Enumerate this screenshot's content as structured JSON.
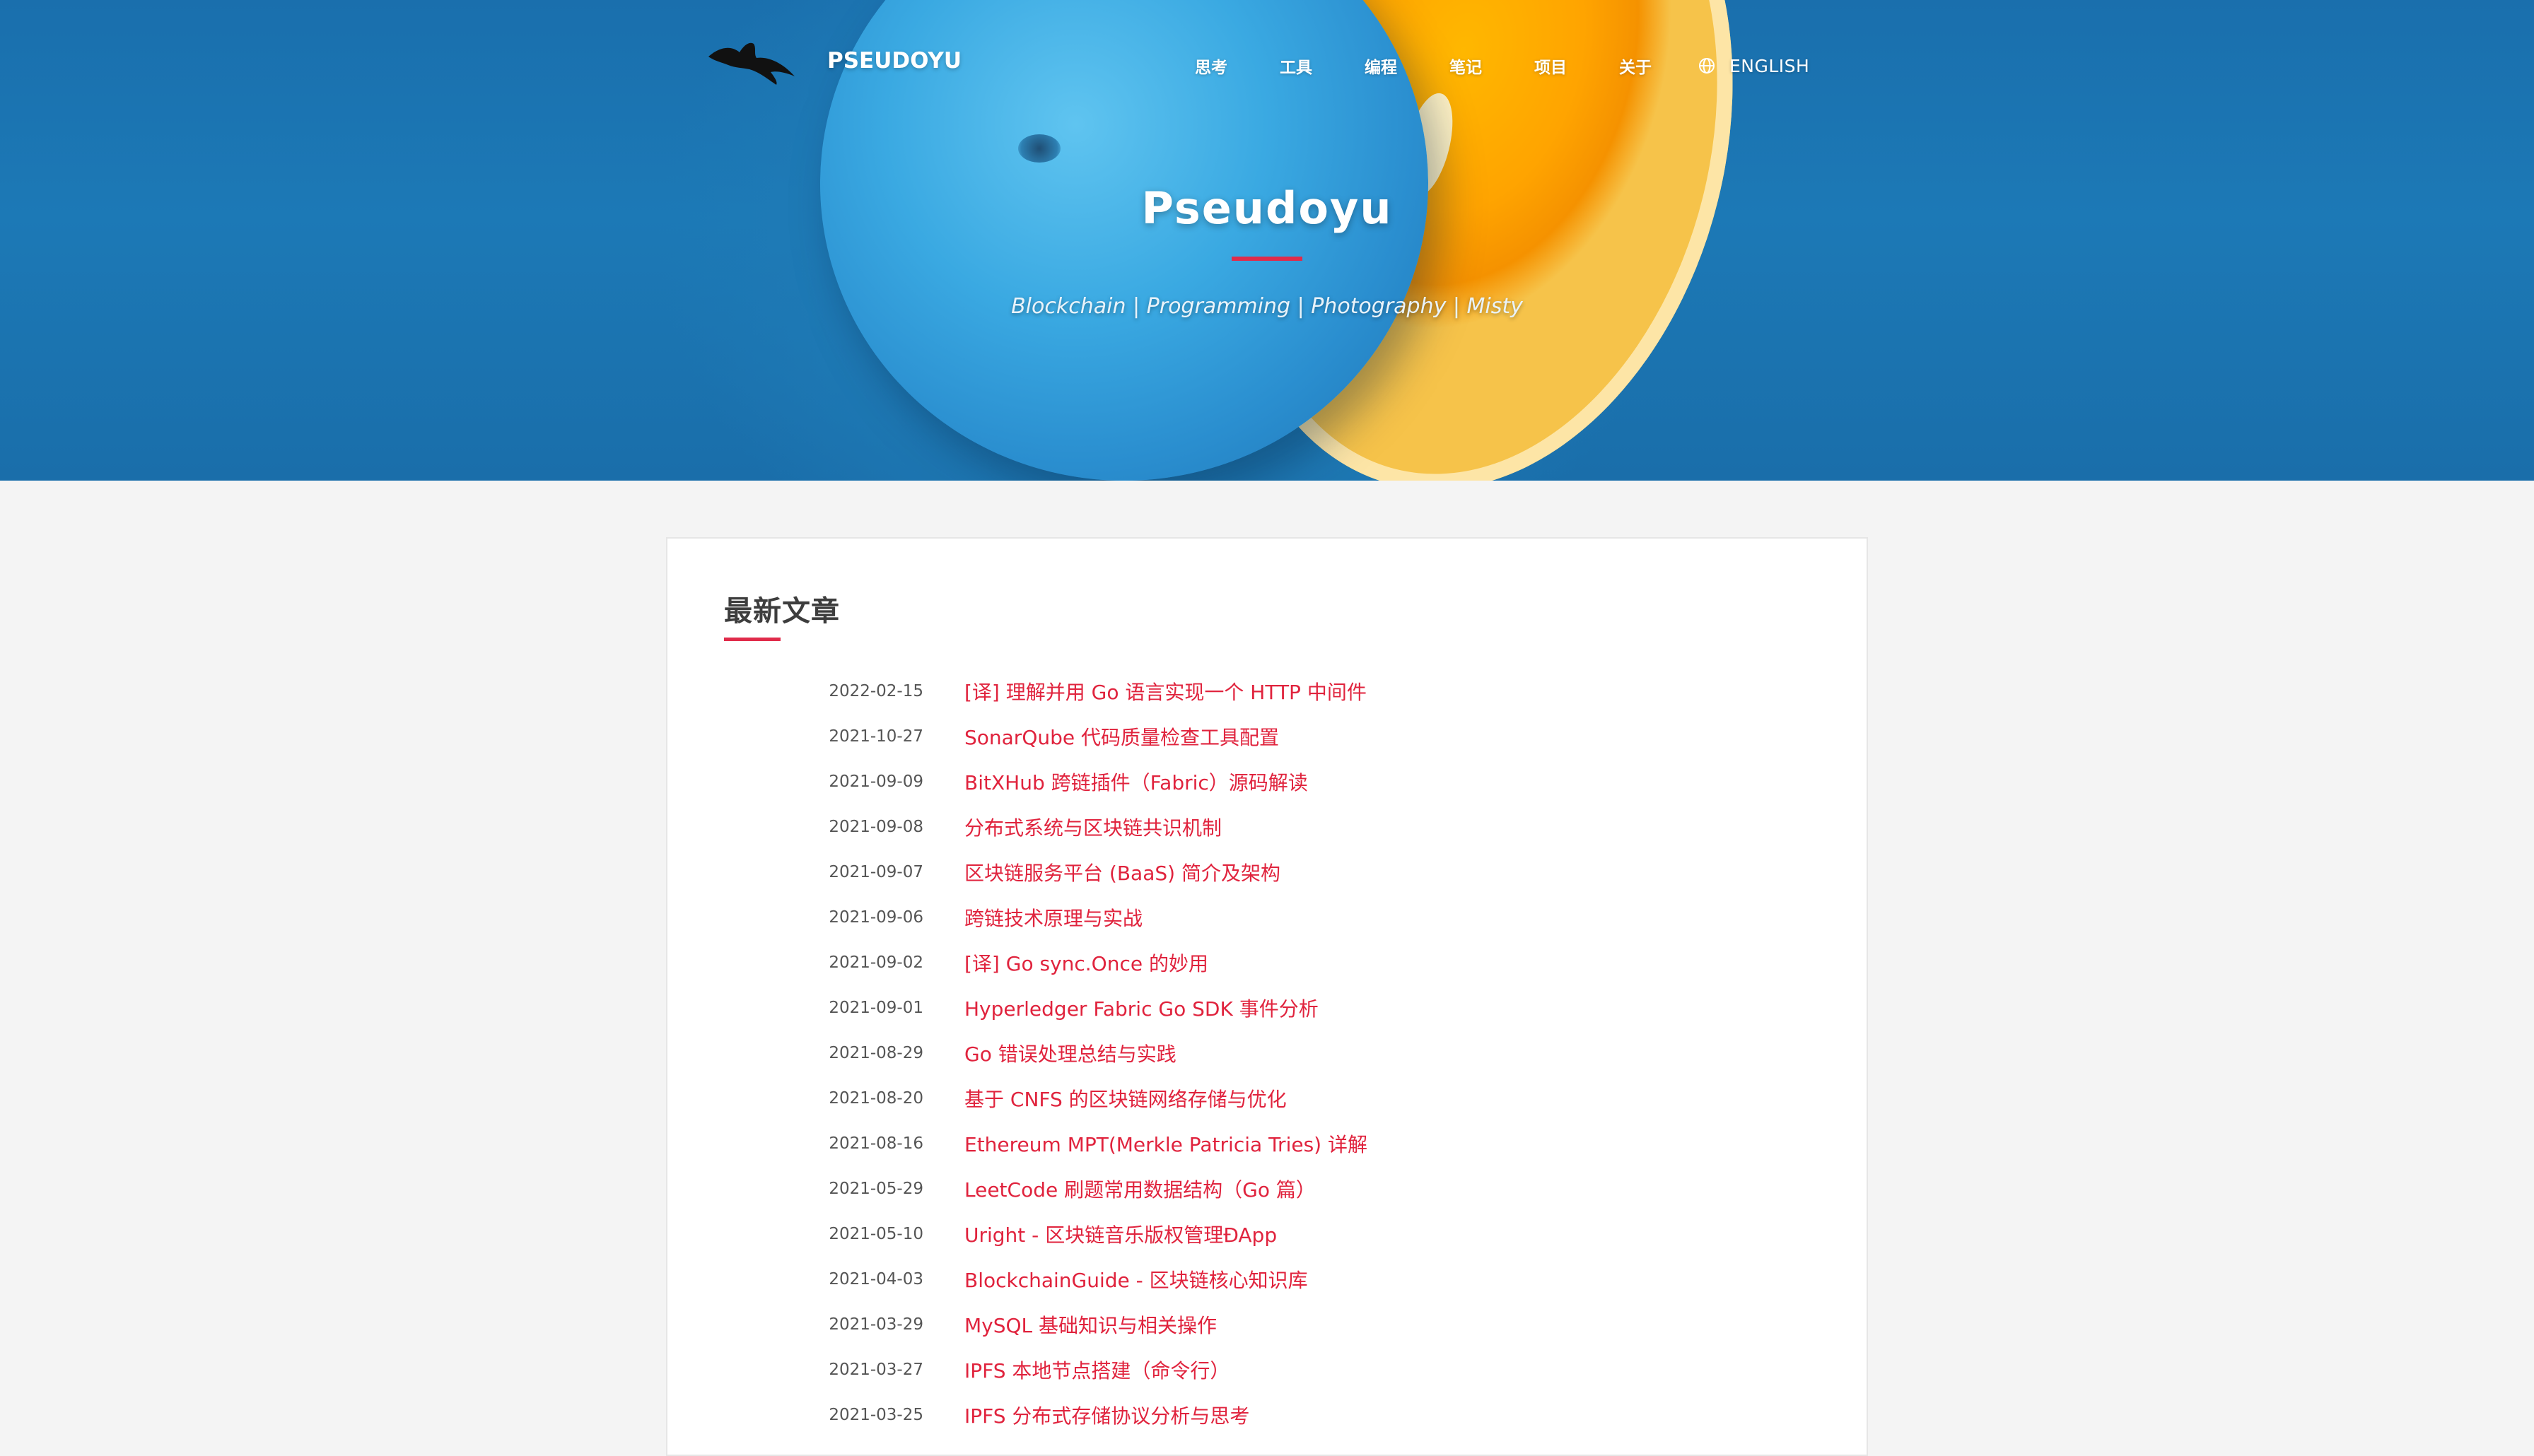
{
  "header": {
    "brand": "PSEUDOYU",
    "nav": [
      "思考",
      "工具",
      "编程",
      "笔记",
      "项目",
      "关于"
    ],
    "language": "ENGLISH",
    "icons": {
      "logo": "bird-logo-icon",
      "language": "globe-icon"
    }
  },
  "hero": {
    "title": "Pseudoyu",
    "subtitle": "Blockchain | Programming | Photography | Misty"
  },
  "main": {
    "section_title": "最新文章",
    "posts": [
      {
        "date": "2022-02-15",
        "title": "[译] 理解并用 Go 语言实现一个 HTTP 中间件"
      },
      {
        "date": "2021-10-27",
        "title": "SonarQube 代码质量检查工具配置"
      },
      {
        "date": "2021-09-09",
        "title": "BitXHub 跨链插件（Fabric）源码解读"
      },
      {
        "date": "2021-09-08",
        "title": "分布式系统与区块链共识机制"
      },
      {
        "date": "2021-09-07",
        "title": "区块链服务平台 (BaaS) 简介及架构"
      },
      {
        "date": "2021-09-06",
        "title": "跨链技术原理与实战"
      },
      {
        "date": "2021-09-02",
        "title": "[译] Go sync.Once 的妙用"
      },
      {
        "date": "2021-09-01",
        "title": "Hyperledger Fabric Go SDK 事件分析"
      },
      {
        "date": "2021-08-29",
        "title": "Go 错误处理总结与实践"
      },
      {
        "date": "2021-08-20",
        "title": "基于 CNFS 的区块链网络存储与优化"
      },
      {
        "date": "2021-08-16",
        "title": "Ethereum MPT(Merkle Patricia Tries) 详解"
      },
      {
        "date": "2021-05-29",
        "title": "LeetCode 刷题常用数据结构（Go 篇）"
      },
      {
        "date": "2021-05-10",
        "title": "Uright - 区块链音乐版权管理ÐApp"
      },
      {
        "date": "2021-04-03",
        "title": "BlockchainGuide - 区块链核心知识库"
      },
      {
        "date": "2021-03-29",
        "title": "MySQL 基础知识与相关操作"
      },
      {
        "date": "2021-03-27",
        "title": "IPFS 本地节点搭建（命令行）"
      },
      {
        "date": "2021-03-25",
        "title": "IPFS 分布式存储协议分析与思考"
      }
    ]
  },
  "colors": {
    "accent": "#e0233d",
    "hero_blue": "#1c79b6",
    "orange": "#ffa400",
    "page_bg": "#f4f4f4"
  }
}
